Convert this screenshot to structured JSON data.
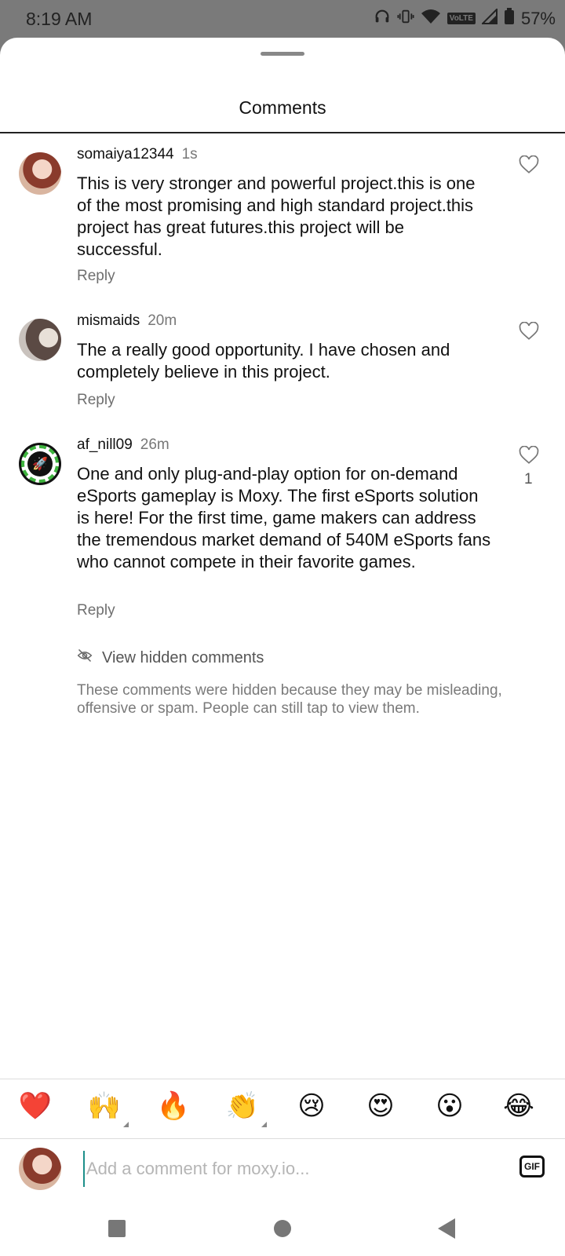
{
  "status_bar": {
    "time": "8:19 AM",
    "network_label": "VoLTE",
    "battery": "57%"
  },
  "sheet": {
    "title": "Comments"
  },
  "comments": [
    {
      "username": "somaiya12344",
      "time": "1s",
      "text": "This is very stronger and powerful project.this is one of the most promising and high standard project.this project has great futures.this project will be successful.",
      "reply_label": "Reply",
      "likes": ""
    },
    {
      "username": "mismaids",
      "time": "20m",
      "text": "The a really good opportunity. I have chosen and completely believe in this project.",
      "reply_label": "Reply",
      "likes": ""
    },
    {
      "username": "af_nill09",
      "time": "26m",
      "text": "One and only plug-and-play option for on-demand eSports gameplay is Moxy. The first eSports solution is here! For the first time, game makers can address the tremendous market demand of 540M eSports fans who cannot compete in their favorite games.",
      "reply_label": "Reply",
      "likes": "1"
    }
  ],
  "hidden_comments": {
    "link_label": "View hidden comments",
    "note": "These comments were hidden because they may be misleading, offensive or spam. People can still tap to view them."
  },
  "emoji_bar": [
    "❤️",
    "🙌",
    "🔥",
    "👏",
    "😢",
    "😍",
    "😮",
    "😂"
  ],
  "composer": {
    "placeholder": "Add a comment for moxy.io...",
    "gif_label": "GIF"
  },
  "colors": {
    "accent_cursor": "#1d8f8a",
    "heart": "#e0242f"
  }
}
